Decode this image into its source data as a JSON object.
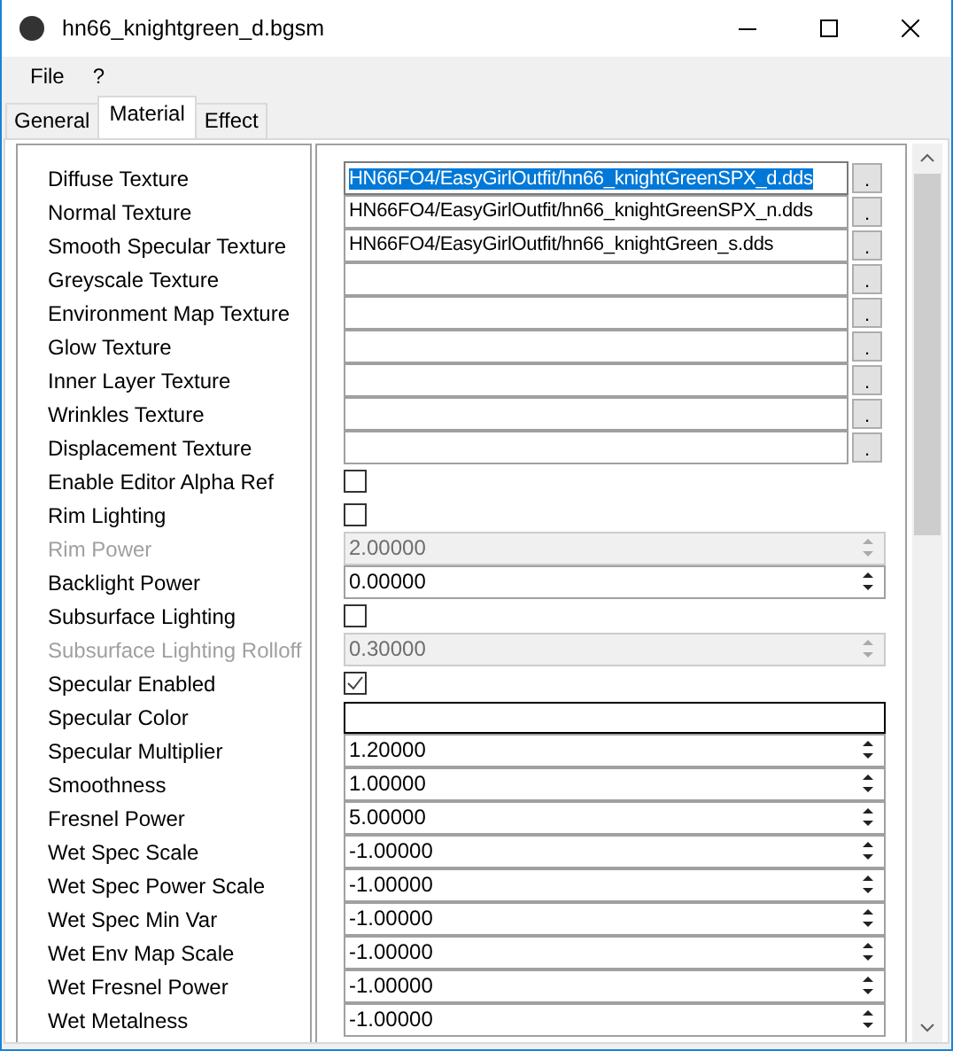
{
  "window": {
    "title": "hn66_knightgreen_d.bgsm"
  },
  "menu": [
    "File",
    "?"
  ],
  "tabs": [
    {
      "label": "General",
      "selected": false
    },
    {
      "label": "Material",
      "selected": true
    },
    {
      "label": "Effect",
      "selected": false
    }
  ],
  "rows": [
    {
      "kind": "texture",
      "label": "Diffuse Texture",
      "value": "HN66FO4/EasyGirlOutfit/hn66_knightGreenSPX_d.dds",
      "selected": true,
      "button": "."
    },
    {
      "kind": "texture",
      "label": "Normal Texture",
      "value": "HN66FO4/EasyGirlOutfit/hn66_knightGreenSPX_n.dds",
      "button": "."
    },
    {
      "kind": "texture",
      "label": "Smooth Specular Texture",
      "value": "HN66FO4/EasyGirlOutfit/hn66_knightGreen_s.dds",
      "button": "."
    },
    {
      "kind": "texture",
      "label": "Greyscale Texture",
      "button": "."
    },
    {
      "kind": "texture",
      "label": "Environment Map Texture",
      "button": "."
    },
    {
      "kind": "texture",
      "label": "Glow Texture",
      "button": "."
    },
    {
      "kind": "texture",
      "label": "Inner Layer Texture",
      "button": "."
    },
    {
      "kind": "texture",
      "label": "Wrinkles Texture",
      "button": "."
    },
    {
      "kind": "texture",
      "label": "Displacement Texture",
      "button": "."
    },
    {
      "kind": "checkbox",
      "label": "Enable Editor Alpha Ref",
      "checked": false
    },
    {
      "kind": "checkbox",
      "label": "Rim Lighting",
      "checked": false
    },
    {
      "kind": "spin",
      "label": "Rim Power",
      "value": "2.00000",
      "disabled": true
    },
    {
      "kind": "spin",
      "label": "Backlight Power",
      "value": "0.00000",
      "disabled": false
    },
    {
      "kind": "checkbox",
      "label": "Subsurface Lighting",
      "checked": false
    },
    {
      "kind": "spin",
      "label": "Subsurface Lighting Rolloff",
      "value": "0.30000",
      "disabled": true
    },
    {
      "kind": "checkbox",
      "label": "Specular Enabled",
      "checked": true
    },
    {
      "kind": "color",
      "label": "Specular Color"
    },
    {
      "kind": "spin",
      "label": "Specular Multiplier",
      "value": "1.20000",
      "disabled": false
    },
    {
      "kind": "spin",
      "label": "Smoothness",
      "value": "1.00000",
      "disabled": false
    },
    {
      "kind": "spin",
      "label": "Fresnel Power",
      "value": "5.00000",
      "disabled": false
    },
    {
      "kind": "spin",
      "label": "Wet Spec Scale",
      "value": "-1.00000",
      "disabled": false
    },
    {
      "kind": "spin",
      "label": "Wet Spec Power Scale",
      "value": "-1.00000",
      "disabled": false
    },
    {
      "kind": "spin",
      "label": "Wet Spec Min Var",
      "value": "-1.00000",
      "disabled": false
    },
    {
      "kind": "spin",
      "label": "Wet Env Map Scale",
      "value": "-1.00000",
      "disabled": false
    },
    {
      "kind": "spin",
      "label": "Wet Fresnel Power",
      "value": "-1.00000",
      "disabled": false
    },
    {
      "kind": "spin",
      "label": "Wet Metalness",
      "value": "-1.00000",
      "disabled": false
    }
  ]
}
